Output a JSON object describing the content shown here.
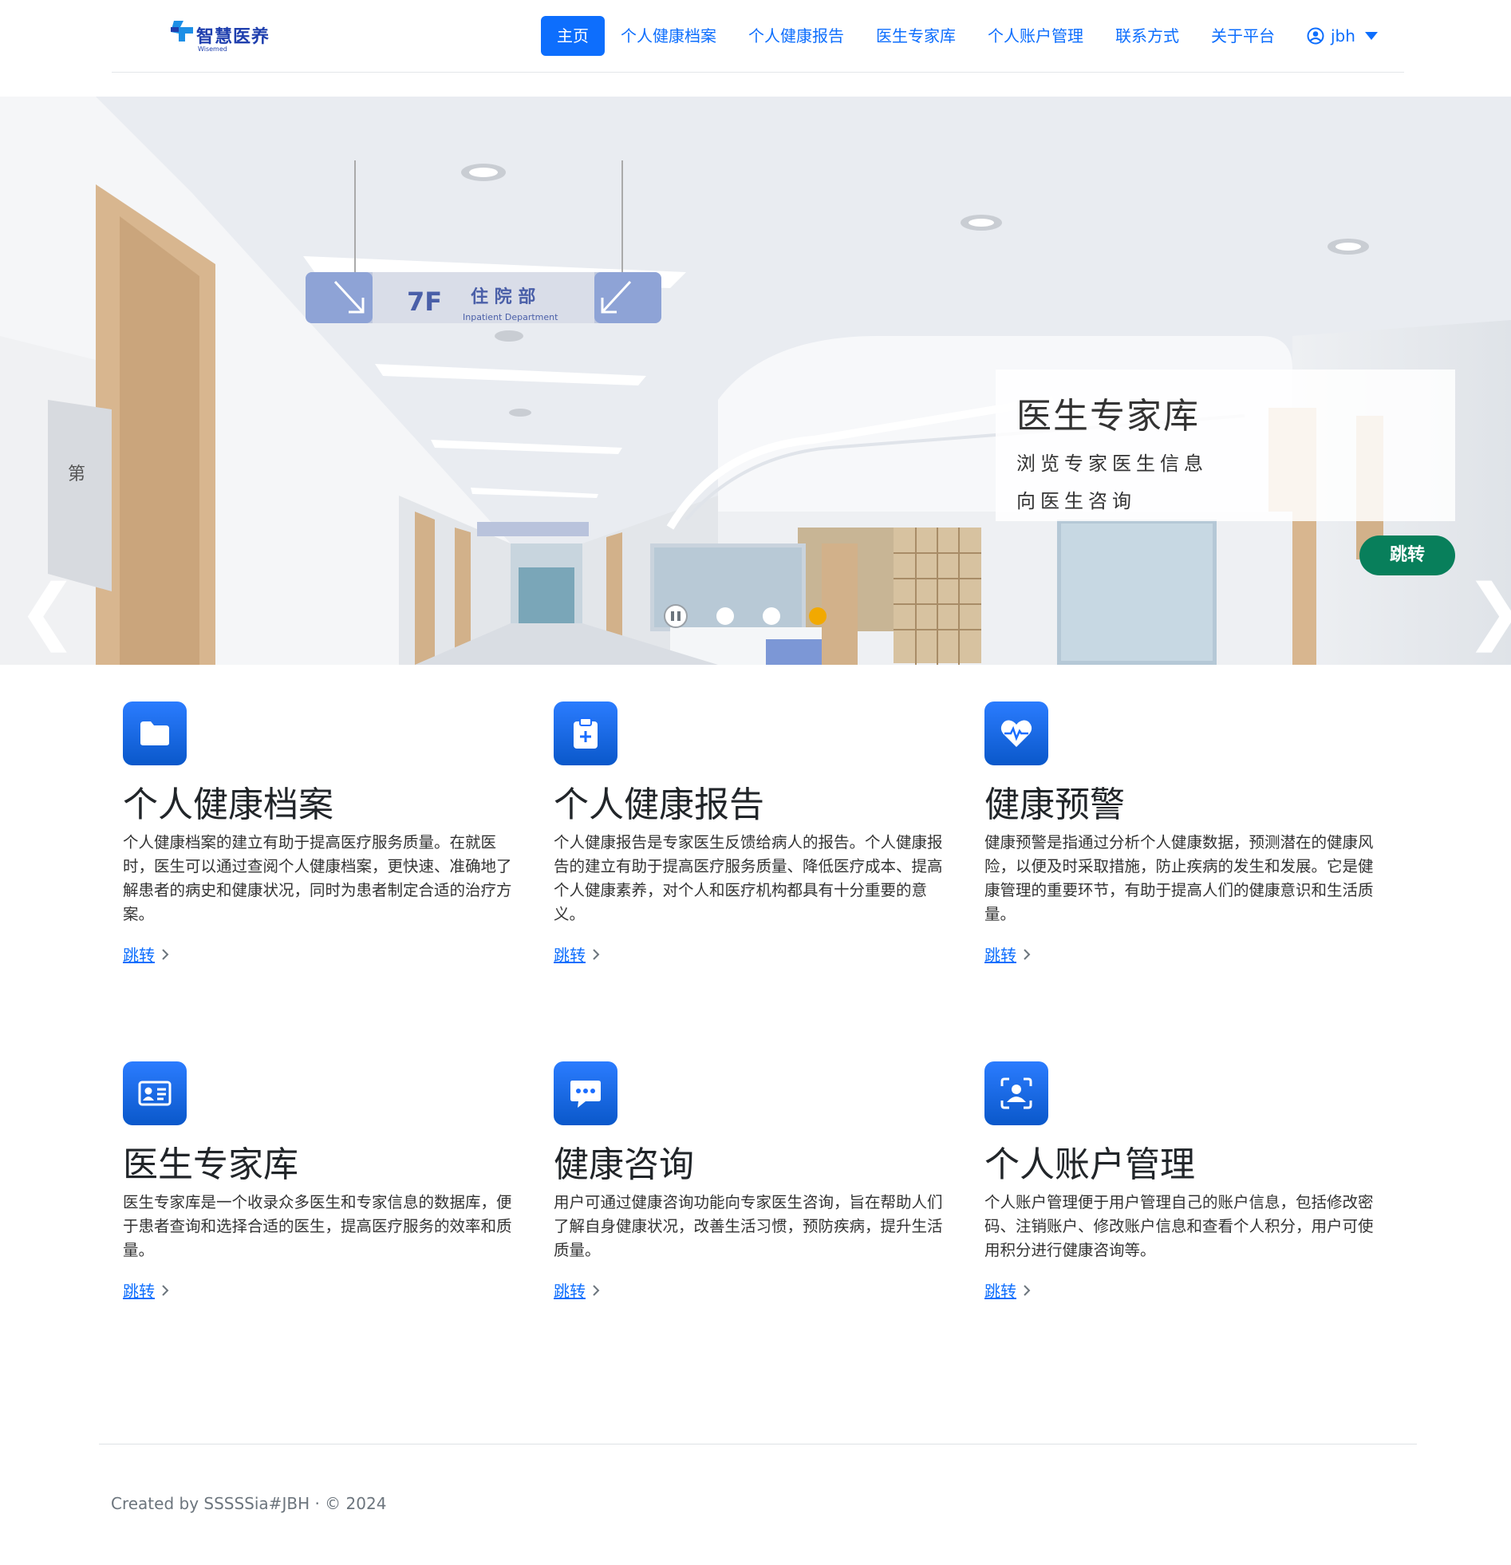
{
  "logo": {
    "text": "智慧医养",
    "sub": "Wisemed"
  },
  "nav": {
    "items": [
      {
        "label": "主页",
        "active": true
      },
      {
        "label": "个人健康档案"
      },
      {
        "label": "个人健康报告"
      },
      {
        "label": "医生专家库"
      },
      {
        "label": "个人账户管理"
      },
      {
        "label": "联系方式"
      },
      {
        "label": "关于平台"
      }
    ],
    "user": "jbh"
  },
  "carousel": {
    "caption_title": "医生专家库",
    "caption_line1": "浏览专家医生信息",
    "caption_line2": "向医生咨询",
    "button": "跳转",
    "prev": "❮",
    "next": "❯",
    "slide_count": 3,
    "active_index": 2,
    "sign": {
      "floor": "7F",
      "title": "住 院 部",
      "sub": "Inpatient  Department"
    },
    "colors": {
      "button": "#087f5b",
      "active_indicator": "#f2a900"
    }
  },
  "features": [
    {
      "icon": "folder-icon",
      "title": "个人健康档案",
      "desc": "个人健康档案的建立有助于提高医疗服务质量。在就医时，医生可以通过查阅个人健康档案，更快速、准确地了解患者的病史和健康状况，同时为患者制定合适的治疗方案。",
      "link": "跳转"
    },
    {
      "icon": "clipboard-plus-icon",
      "title": "个人健康报告",
      "desc": "个人健康报告是专家医生反馈给病人的报告。个人健康报告的建立有助于提高医疗服务质量、降低医疗成本、提高个人健康素养，对个人和医疗机构都具有十分重要的意义。",
      "link": "跳转"
    },
    {
      "icon": "heart-pulse-icon",
      "title": "健康预警",
      "desc": "健康预警是指通过分析个人健康数据，预测潜在的健康风险，以便及时采取措施，防止疾病的发生和发展。它是健康管理的重要环节，有助于提高人们的健康意识和生活质量。",
      "link": "跳转"
    },
    {
      "icon": "id-card-icon",
      "title": "医生专家库",
      "desc": "医生专家库是一个收录众多医生和专家信息的数据库，便于患者查询和选择合适的医生，提高医疗服务的效率和质量。",
      "link": "跳转"
    },
    {
      "icon": "chat-dots-icon",
      "title": "健康咨询",
      "desc": "用户可通过健康咨询功能向专家医生咨询，旨在帮助人们了解自身健康状况，改善生活习惯，预防疾病，提升生活质量。",
      "link": "跳转"
    },
    {
      "icon": "person-bounding-box-icon",
      "title": "个人账户管理",
      "desc": "个人账户管理便于用户管理自己的账户信息，包括修改密码、注销账户、修改账户信息和查看个人积分，用户可使用积分进行健康咨询等。",
      "link": "跳转"
    }
  ],
  "footer": {
    "text": "Created by SSSSSia#JBH · © 2024"
  },
  "colors": {
    "primary": "#0d6efd",
    "icon_bg": "#1a6dff"
  }
}
